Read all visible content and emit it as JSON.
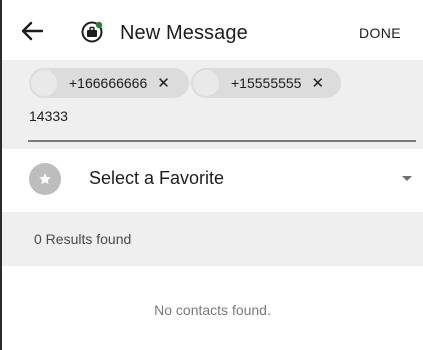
{
  "header": {
    "title": "New Message",
    "done_label": "DONE"
  },
  "recipients": {
    "chips": [
      {
        "number": "+166666666",
        "remove": "✕"
      },
      {
        "number": "+15555555",
        "remove": "✕"
      }
    ],
    "input_value": "14333"
  },
  "favorite": {
    "label": "Select a Favorite"
  },
  "results": {
    "count_text": "0 Results found",
    "empty_text": "No contacts found."
  },
  "colors": {
    "brand_badge": "#2e7d32",
    "chip_bg": "#dcdcdc",
    "panel_bg": "#efefef",
    "icon_grey": "#bdbdbd"
  },
  "icons": [
    "back-arrow-icon",
    "briefcase-app-icon",
    "avatar-placeholder-icon",
    "close-icon",
    "star-icon",
    "dropdown-caret-icon"
  ]
}
